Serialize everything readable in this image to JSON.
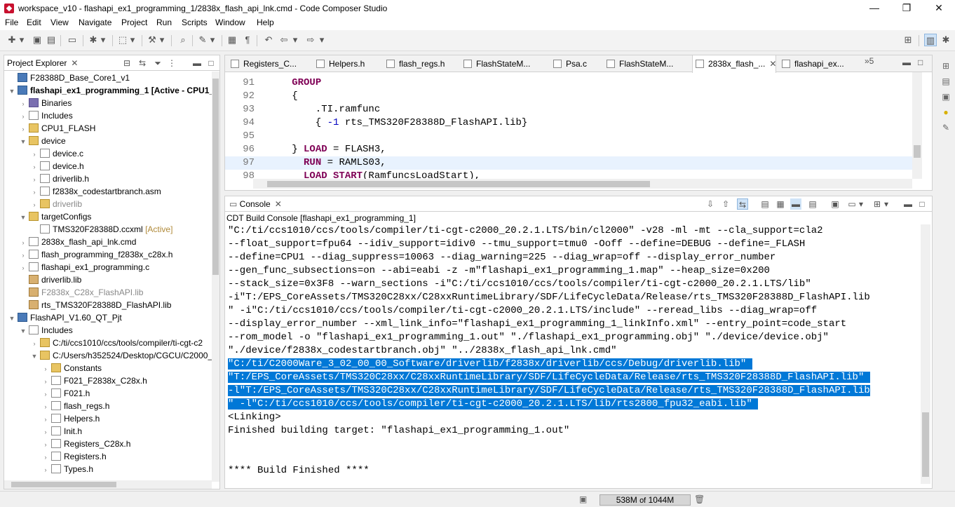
{
  "window": {
    "title": "workspace_v10 - flashapi_ex1_programming_1/2838x_flash_api_lnk.cmd - Code Composer Studio",
    "minimize": "—",
    "maximize": "❐",
    "close": "✕"
  },
  "menu": [
    "File",
    "Edit",
    "View",
    "Navigate",
    "Project",
    "Run",
    "Scripts",
    "Window",
    "Help"
  ],
  "project_explorer": {
    "title": "Project Explorer",
    "tree": [
      {
        "label": "F28388D_Base_Core1_v1",
        "icon": "project-icon",
        "indent": 0,
        "twisty": ""
      },
      {
        "label": "flashapi_ex1_programming_1",
        "suffix": "[Active - CPU1_",
        "icon": "project-icon",
        "indent": 0,
        "twisty": "▼",
        "bold": true
      },
      {
        "label": "Binaries",
        "icon": "binaries-icon",
        "indent": 1,
        "twisty": "›"
      },
      {
        "label": "Includes",
        "icon": "includes-icon",
        "indent": 1,
        "twisty": "›"
      },
      {
        "label": "CPU1_FLASH",
        "icon": "folder-icon",
        "indent": 1,
        "twisty": "›"
      },
      {
        "label": "device",
        "icon": "folder-icon",
        "indent": 1,
        "twisty": "▼"
      },
      {
        "label": "device.c",
        "icon": "c-file-icon",
        "indent": 2,
        "twisty": "›"
      },
      {
        "label": "device.h",
        "icon": "h-file-icon",
        "indent": 2,
        "twisty": "›"
      },
      {
        "label": "driverlib.h",
        "icon": "h-file-icon",
        "indent": 2,
        "twisty": "›"
      },
      {
        "label": "f2838x_codestartbranch.asm",
        "icon": "asm-file-icon",
        "indent": 2,
        "twisty": "›"
      },
      {
        "label": "driverlib",
        "icon": "folder-icon",
        "indent": 2,
        "twisty": "›",
        "grey": true
      },
      {
        "label": "targetConfigs",
        "icon": "folder-icon",
        "indent": 1,
        "twisty": "▼"
      },
      {
        "label": "TMS320F28388D.ccxml",
        "suffix": "[Active]",
        "icon": "ccxml-file-icon",
        "indent": 2,
        "twisty": ""
      },
      {
        "label": "2838x_flash_api_lnk.cmd",
        "icon": "cmd-file-icon",
        "indent": 1,
        "twisty": "›"
      },
      {
        "label": "flash_programming_f2838x_c28x.h",
        "icon": "h-file-icon",
        "indent": 1,
        "twisty": "›"
      },
      {
        "label": "flashapi_ex1_programming.c",
        "icon": "c-file-icon",
        "indent": 1,
        "twisty": "›"
      },
      {
        "label": "driverlib.lib",
        "icon": "lib-file-icon",
        "indent": 1,
        "twisty": ""
      },
      {
        "label": "F2838x_C28x_FlashAPI.lib",
        "icon": "lib-file-icon",
        "indent": 1,
        "twisty": "",
        "grey": true
      },
      {
        "label": "rts_TMS320F28388D_FlashAPI.lib",
        "icon": "lib-file-icon",
        "indent": 1,
        "twisty": ""
      },
      {
        "label": "FlashAPI_V1.60_QT_Pjt",
        "icon": "project-icon",
        "indent": 0,
        "twisty": "▼"
      },
      {
        "label": "Includes",
        "icon": "includes-icon",
        "indent": 1,
        "twisty": "▼"
      },
      {
        "label": "C:/ti/ccs1010/ccs/tools/compiler/ti-cgt-c2",
        "icon": "include-folder-icon",
        "indent": 2,
        "twisty": "›"
      },
      {
        "label": "C:/Users/h352524/Desktop/CGCU/C2000_I",
        "icon": "include-folder-icon",
        "indent": 2,
        "twisty": "▼"
      },
      {
        "label": "Constants",
        "icon": "folder-icon",
        "indent": 3,
        "twisty": "›"
      },
      {
        "label": "F021_F2838x_C28x.h",
        "icon": "h-file-icon",
        "indent": 3,
        "twisty": "›"
      },
      {
        "label": "F021.h",
        "icon": "h-file-icon",
        "indent": 3,
        "twisty": "›"
      },
      {
        "label": "flash_regs.h",
        "icon": "h-file-icon",
        "indent": 3,
        "twisty": "›"
      },
      {
        "label": "Helpers.h",
        "icon": "h-file-icon",
        "indent": 3,
        "twisty": "›"
      },
      {
        "label": "Init.h",
        "icon": "h-file-icon",
        "indent": 3,
        "twisty": "›"
      },
      {
        "label": "Registers_C28x.h",
        "icon": "h-file-icon",
        "indent": 3,
        "twisty": "›"
      },
      {
        "label": "Registers.h",
        "icon": "h-file-icon",
        "indent": 3,
        "twisty": "›"
      },
      {
        "label": "Types.h",
        "icon": "h-file-icon",
        "indent": 3,
        "twisty": "›"
      }
    ]
  },
  "editor": {
    "tabs": [
      {
        "label": "Registers_C...",
        "active": false
      },
      {
        "label": "Helpers.h",
        "active": false
      },
      {
        "label": "flash_regs.h",
        "active": false
      },
      {
        "label": "FlashStateM...",
        "active": false
      },
      {
        "label": "Psa.c",
        "active": false
      },
      {
        "label": "FlashStateM...",
        "active": false
      },
      {
        "label": "2838x_flash_...",
        "active": true
      },
      {
        "label": "flashapi_ex...",
        "active": false
      }
    ],
    "overflow": "»5",
    "lines": [
      {
        "n": "91",
        "html": "   <span class=\"kw\">GROUP</span>"
      },
      {
        "n": "92",
        "html": "   {"
      },
      {
        "n": "93",
        "html": "       .TI.ramfunc"
      },
      {
        "n": "94",
        "html": "       { <span class=\"num\">-1</span> rts_TMS320F28388D_FlashAPI.lib}"
      },
      {
        "n": "95",
        "html": ""
      },
      {
        "n": "96",
        "html": "   } <span class=\"kw\">LOAD</span> = FLASH3,"
      },
      {
        "n": "97",
        "html": "     <span class=\"kw\">RUN</span> = RAMLS03,",
        "current": true
      },
      {
        "n": "98",
        "html": "     <span class=\"kw\">LOAD_START</span>(RamfuncsLoadStart),"
      }
    ]
  },
  "console": {
    "tab": "Console",
    "subtitle": "CDT Build Console [flashapi_ex1_programming_1]",
    "lines": [
      {
        "t": "\"C:/ti/ccs1010/ccs/tools/compiler/ti-cgt-c2000_20.2.1.LTS/bin/cl2000\" -v28 -ml -mt --cla_support=cla2"
      },
      {
        "t": "--float_support=fpu64 --idiv_support=idiv0 --tmu_support=tmu0 -Ooff --define=DEBUG --define=_FLASH"
      },
      {
        "t": "--define=CPU1 --diag_suppress=10063 --diag_warning=225 --diag_wrap=off --display_error_number"
      },
      {
        "t": "--gen_func_subsections=on --abi=eabi -z -m\"flashapi_ex1_programming_1.map\" --heap_size=0x200"
      },
      {
        "t": "--stack_size=0x3F8 --warn_sections -i\"C:/ti/ccs1010/ccs/tools/compiler/ti-cgt-c2000_20.2.1.LTS/lib\""
      },
      {
        "t": "-i\"T:/EPS_CoreAssets/TMS320C28xx/C28xxRuntimeLibrary/SDF/LifeCycleData/Release/rts_TMS320F28388D_FlashAPI.lib"
      },
      {
        "t": "\" -i\"C:/ti/ccs1010/ccs/tools/compiler/ti-cgt-c2000_20.2.1.LTS/include\" --reread_libs --diag_wrap=off"
      },
      {
        "t": "--display_error_number --xml_link_info=\"flashapi_ex1_programming_1_linkInfo.xml\" --entry_point=code_start"
      },
      {
        "t": "--rom_model -o \"flashapi_ex1_programming_1.out\" \"./flashapi_ex1_programming.obj\" \"./device/device.obj\""
      },
      {
        "t": "\"./device/f2838x_codestartbranch.obj\" \"../2838x_flash_api_lnk.cmd\""
      },
      {
        "t": "\"C:/ti/C2000Ware_3_02_00_00_Software/driverlib/f2838x/driverlib/ccs/Debug/driverlib.lib\" ",
        "sel": true
      },
      {
        "t": "\"T:/EPS_CoreAssets/TMS320C28xx/C28xxRuntimeLibrary/SDF/LifeCycleData/Release/rts_TMS320F28388D_FlashAPI.lib\" ",
        "sel": true
      },
      {
        "t": "-l\"T:/EPS_CoreAssets/TMS320C28xx/C28xxRuntimeLibrary/SDF/LifeCycleData/Release/rts_TMS320F28388D_FlashAPI.lib",
        "sel": true
      },
      {
        "t": "\" -l\"C:/ti/ccs1010/ccs/tools/compiler/ti-cgt-c2000_20.2.1.LTS/lib/rts2800_fpu32_eabi.lib\" ",
        "sel": true
      },
      {
        "t": "<Linking>"
      },
      {
        "t": "Finished building target: \"flashapi_ex1_programming_1.out\""
      },
      {
        "t": ""
      },
      {
        "t": ""
      },
      {
        "t": "**** Build Finished ****"
      }
    ]
  },
  "status": {
    "heap_used": "538M",
    "heap_of": "of",
    "heap_total": "1044M"
  }
}
